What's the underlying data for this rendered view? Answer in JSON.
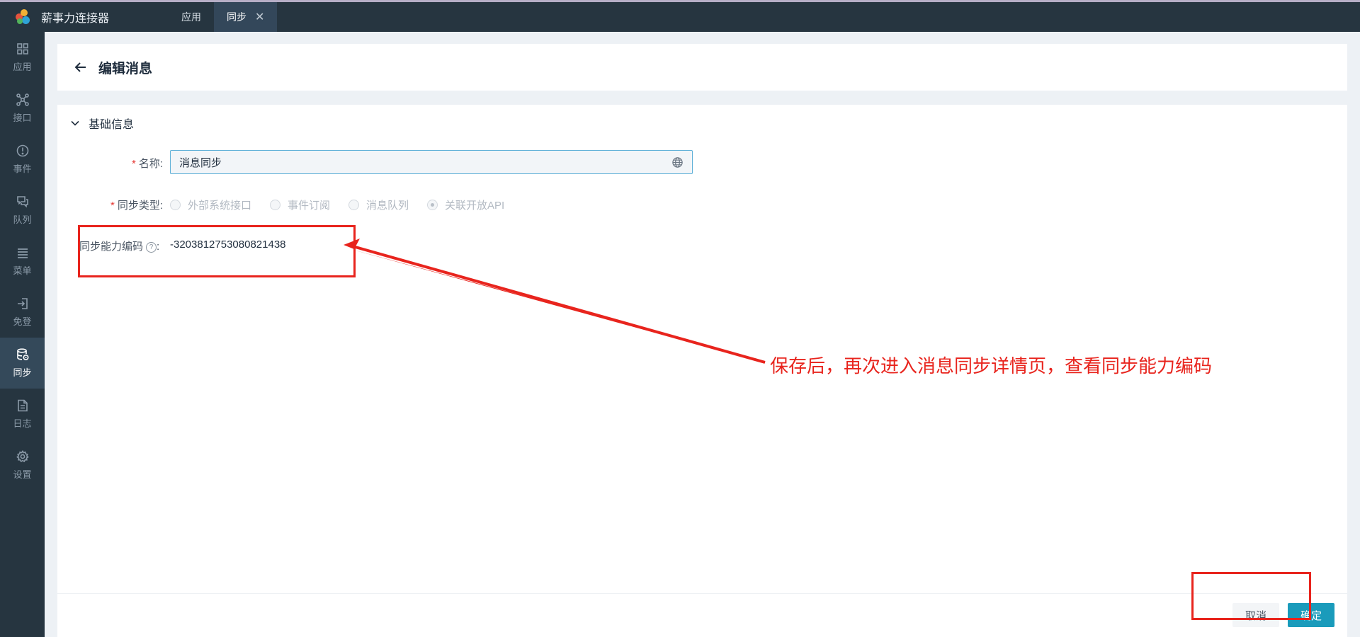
{
  "app": {
    "brand": "薪事力连接器",
    "tabs": [
      {
        "label": "应用",
        "active": false
      },
      {
        "label": "同步",
        "active": true,
        "close_glyph": "✕"
      }
    ]
  },
  "sidebar": {
    "items": [
      {
        "label": "应用",
        "icon": "grid-icon"
      },
      {
        "label": "接口",
        "icon": "interface-icon"
      },
      {
        "label": "事件",
        "icon": "alert-icon"
      },
      {
        "label": "队列",
        "icon": "queue-icon"
      },
      {
        "label": "菜单",
        "icon": "menu-icon"
      },
      {
        "label": "免登",
        "icon": "login-icon"
      },
      {
        "label": "同步",
        "icon": "database-icon",
        "active": true
      },
      {
        "label": "日志",
        "icon": "document-icon"
      },
      {
        "label": "设置",
        "icon": "gear-icon"
      }
    ]
  },
  "header": {
    "title": "编辑消息"
  },
  "form": {
    "section_title": "基础信息",
    "name": {
      "required_mark": "*",
      "label": "名称:",
      "value": "消息同步"
    },
    "sync_type": {
      "required_mark": "*",
      "label": "同步类型:",
      "options": [
        "外部系统接口",
        "事件订阅",
        "消息队列",
        "关联开放API"
      ],
      "selected": "关联开放API"
    },
    "capability_code": {
      "label": "同步能力编码",
      "help_glyph": "?",
      "colon": ":",
      "value": "-3203812753080821438"
    }
  },
  "footer": {
    "cancel_label": "取消",
    "ok_label": "确定"
  },
  "annotation": {
    "text": "保存后，再次进入消息同步详情页，查看同步能力编码",
    "color": "#e8241d"
  },
  "colors": {
    "topbar": "#263540",
    "primary": "#1a9bbb",
    "active_sidebar": "#34495a"
  }
}
